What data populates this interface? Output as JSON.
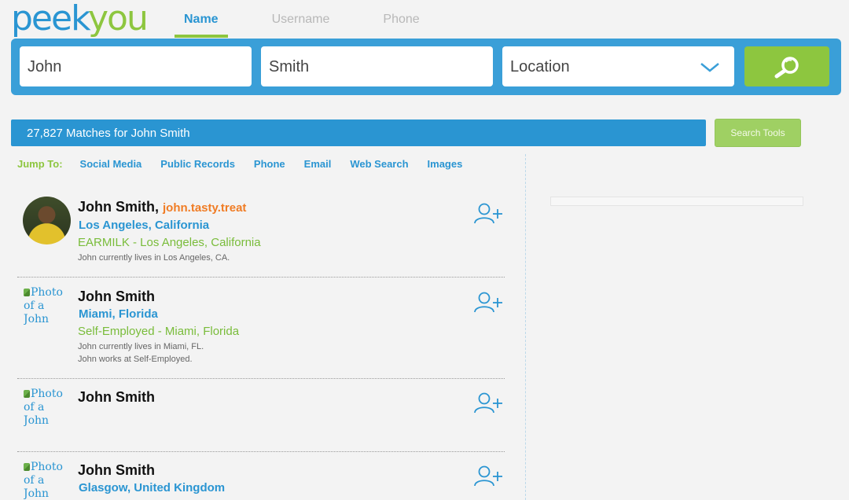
{
  "brand": {
    "peek": "peek",
    "you": "you"
  },
  "tabs": [
    {
      "label": "Name",
      "active": true
    },
    {
      "label": "Username"
    },
    {
      "label": "Phone"
    }
  ],
  "search": {
    "first_name": "John",
    "last_name": "Smith",
    "location": "Location"
  },
  "results": {
    "summary": "27,827 Matches for John Smith",
    "search_tools_label": "Search Tools"
  },
  "jump": {
    "label": "Jump To:",
    "links": [
      "Social Media",
      "Public Records",
      "Phone",
      "Email",
      "Web Search",
      "Images"
    ]
  },
  "people": [
    {
      "name": "John Smith,",
      "handle": "john.tasty.treat",
      "location": "Los Angeles, California",
      "job": "EARMILK - Los Angeles, California",
      "notes": [
        "John currently lives in Los Angeles, CA."
      ]
    },
    {
      "name": "John Smith",
      "photo_alt": "Photo of a John Smith",
      "location": "Miami, Florida",
      "job": "Self-Employed - Miami, Florida",
      "notes": [
        "John currently lives in Miami, FL.",
        "John works at Self-Employed."
      ]
    },
    {
      "name": "John Smith",
      "photo_alt": "Photo of a John Smith"
    },
    {
      "name": "John Smith",
      "photo_alt": "Photo of a John Smith",
      "location": "Glasgow, United Kingdom"
    }
  ],
  "colors": {
    "blue": "#2a95d2",
    "green": "#8dc63f",
    "orange": "#f07c24"
  },
  "icons": [
    "search-icon",
    "chevron-down-icon",
    "add-person-icon",
    "broken-image-icon"
  ]
}
